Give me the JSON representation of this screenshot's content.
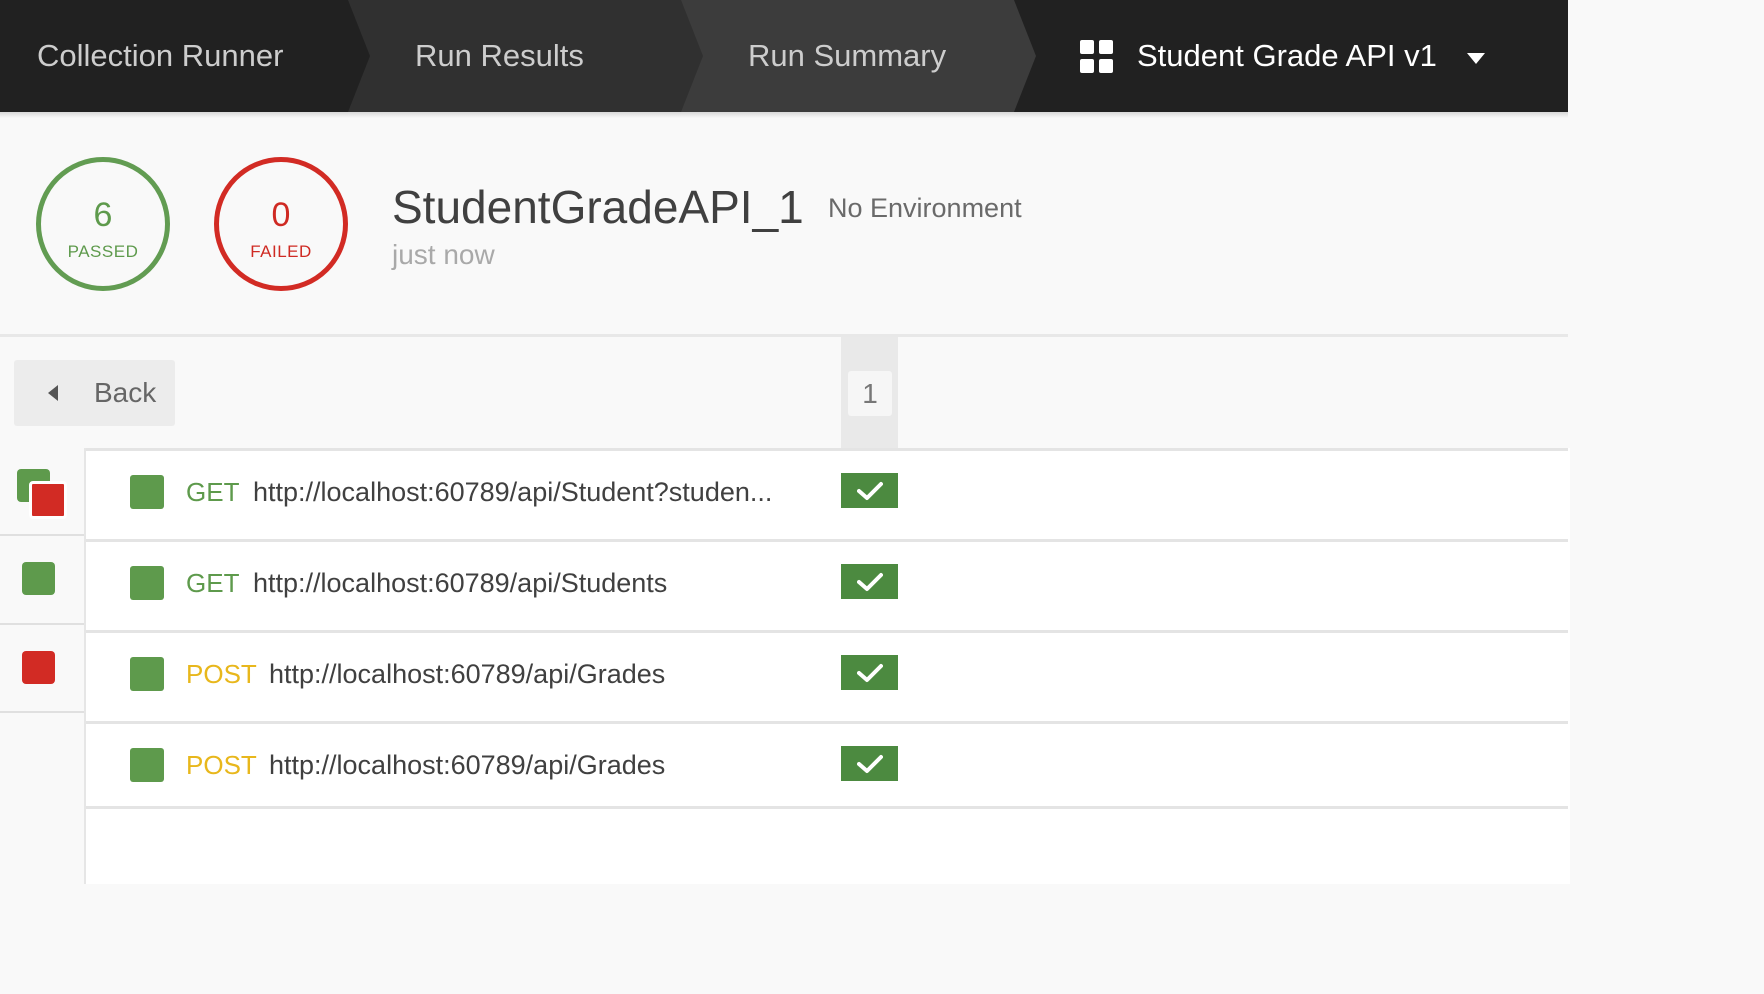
{
  "nav": {
    "steps": [
      {
        "label": "Collection Runner"
      },
      {
        "label": "Run Results"
      },
      {
        "label": "Run Summary"
      }
    ],
    "collection_selector": {
      "label": "Student Grade API v1",
      "icon": "grid-icon"
    }
  },
  "summary": {
    "passed_count": "6",
    "passed_label": "PASSED",
    "failed_count": "0",
    "failed_label": "FAILED",
    "collection_name": "StudentGradeAPI_1",
    "environment": "No Environment",
    "run_time": "just now"
  },
  "back_button": {
    "label": "Back"
  },
  "iterations": [
    "1"
  ],
  "requests": [
    {
      "method": "GET",
      "url": "http://localhost:60789/api/Student?studen..."
    },
    {
      "method": "GET",
      "url": "http://localhost:60789/api/Students"
    },
    {
      "method": "POST",
      "url": "http://localhost:60789/api/Grades"
    },
    {
      "method": "POST",
      "url": "http://localhost:60789/api/Grades"
    }
  ],
  "colors": {
    "pass": "#5e9a4c",
    "fail": "#d22b24",
    "get": "#5e9a4c",
    "post": "#e8b71c",
    "topbar": "#212121"
  }
}
